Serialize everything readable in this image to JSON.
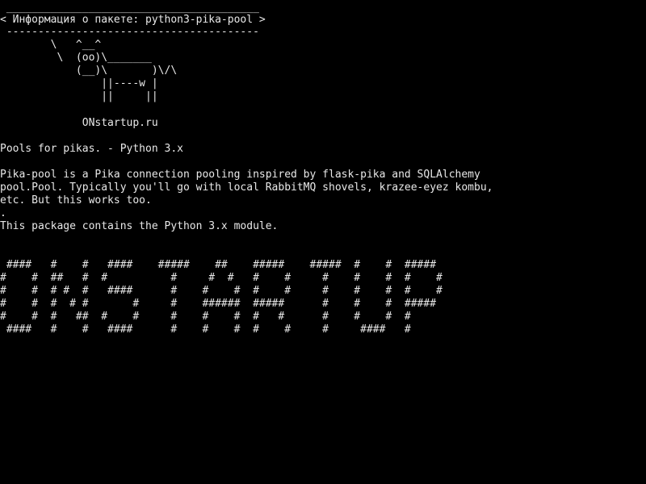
{
  "screen": {
    "background": "#000000",
    "foreground": "#e8e8e8"
  },
  "cowsay": {
    "border_top": " ________________________________________",
    "message": "< Информация о пакете: python3-pika-pool >",
    "border_bottom": " ----------------------------------------",
    "cow": [
      "        \\   ^__^",
      "         \\  (oo)\\_______",
      "            (__)\\       )\\/\\",
      "                ||----w |",
      "                ||     ||"
    ]
  },
  "site": "             ONstartup.ru",
  "summary": "Pools for pikas. - Python 3.x",
  "description": [
    "Pika-pool is a Pika connection pooling inspired by flask-pika and SQLAlchemy",
    "pool.Pool. Typically you'll go with local RabbitMQ shovels, krazee-eyez kombu,",
    "etc. But this works too.",
    ".",
    "This package contains the Python 3.x module."
  ],
  "banner": [
    " ####   #    #   ####    #####    ##    #####    #####  #    #  #####",
    "#    #  ##   #  #          #     #  #   #    #     #    #    #  #    #",
    "#    #  # #  #   ####      #    #    #  #    #     #    #    #  #    #",
    "#    #  #  # #       #     #    ######  #####      #    #    #  #####",
    "#    #  #   ##  #    #     #    #    #  #   #      #    #    #  #",
    " ####   #    #   ####      #    #    #  #    #     #     ####   #"
  ]
}
